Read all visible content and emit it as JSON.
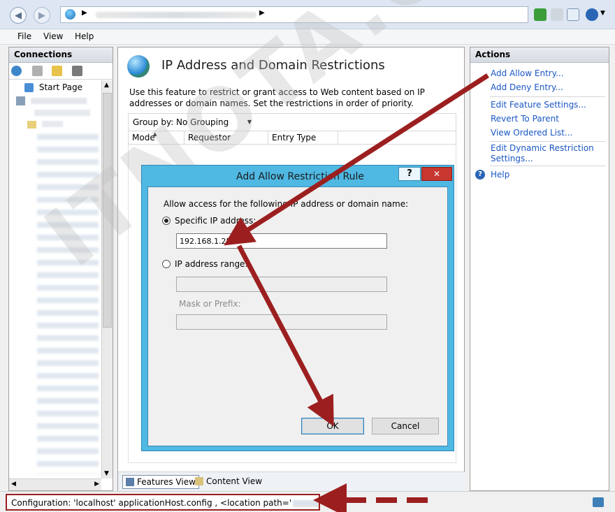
{
  "menu": {
    "file": "File",
    "view": "View",
    "help": "Help"
  },
  "connections": {
    "title": "Connections",
    "start_page": "Start Page"
  },
  "feature": {
    "title": "IP Address and Domain Restrictions",
    "description": "Use this feature to restrict or grant access to Web content based on IP addresses or domain names. Set the restrictions in order of priority.",
    "group_by_label": "Group by:",
    "group_by_value": "No Grouping",
    "columns": [
      "Mode",
      "Requestor",
      "Entry Type"
    ]
  },
  "view_tabs": {
    "features": "Features View",
    "content": "Content View"
  },
  "actions": {
    "title": "Actions",
    "add_allow": "Add Allow Entry...",
    "add_deny": "Add Deny Entry...",
    "edit_feature": "Edit Feature Settings...",
    "revert": "Revert To Parent",
    "view_ordered": "View Ordered List...",
    "edit_dynamic_1": "Edit Dynamic Restriction",
    "edit_dynamic_2": "Settings...",
    "help": "Help"
  },
  "dialog": {
    "title": "Add Allow Restriction Rule",
    "help_btn": "?",
    "close_btn": "✕",
    "prompt": "Allow access for the following IP address or domain name:",
    "specific_ip_label": "Specific IP address:",
    "specific_ip_value": "192.168.1.25",
    "ip_range_label": "IP address range:",
    "mask_label": "Mask or Prefix:",
    "ok": "OK",
    "cancel": "Cancel"
  },
  "status": {
    "config_text": "Configuration: 'localhost' applicationHost.config , <location path='",
    "config_end": "'>"
  },
  "watermark": "ITNOTA.COM",
  "colors": {
    "arrow": "#9c1f1f",
    "link": "#1a57c4",
    "dialog_frame": "#4fb8e3"
  }
}
